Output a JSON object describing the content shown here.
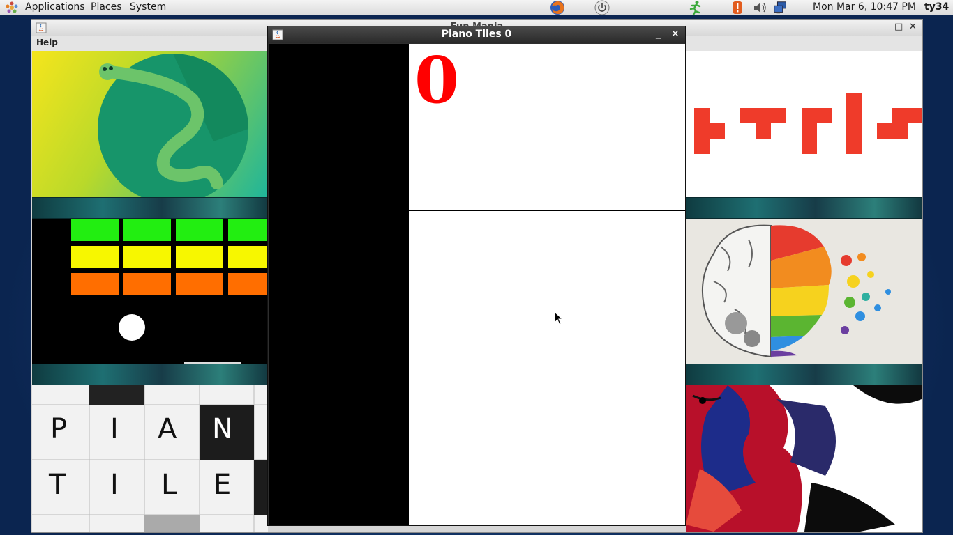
{
  "panel": {
    "menus": [
      "Applications",
      "Places",
      "System"
    ],
    "clock": "Mon Mar  6, 10:47 PM",
    "user": "ty34"
  },
  "main_window": {
    "title": "Fun Mania",
    "help_menu": "Help",
    "piano_preview_letters": [
      "P",
      "I",
      "A",
      "N",
      "T",
      "I",
      "L",
      "E"
    ]
  },
  "piano_window": {
    "title": "Piano Tiles 0",
    "score": "0",
    "black_tiles": [
      [
        0,
        0
      ],
      [
        1,
        0
      ],
      [
        2,
        0
      ]
    ]
  },
  "colors": {
    "score": "#ff0000",
    "tile_black": "#000000",
    "tile_white": "#ffffff"
  }
}
